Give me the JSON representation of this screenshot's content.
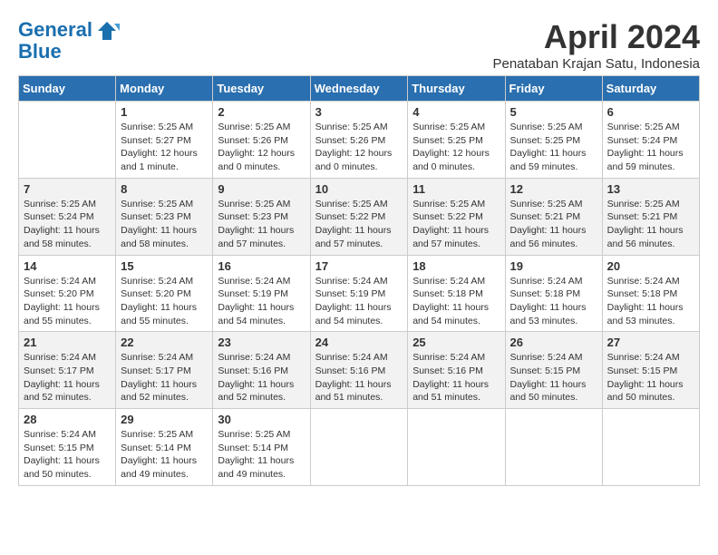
{
  "header": {
    "logo_line1": "General",
    "logo_line2": "Blue",
    "month": "April 2024",
    "location": "Penataban Krajan Satu, Indonesia"
  },
  "days_of_week": [
    "Sunday",
    "Monday",
    "Tuesday",
    "Wednesday",
    "Thursday",
    "Friday",
    "Saturday"
  ],
  "weeks": [
    [
      {
        "day": "",
        "info": ""
      },
      {
        "day": "1",
        "info": "Sunrise: 5:25 AM\nSunset: 5:27 PM\nDaylight: 12 hours\nand 1 minute."
      },
      {
        "day": "2",
        "info": "Sunrise: 5:25 AM\nSunset: 5:26 PM\nDaylight: 12 hours\nand 0 minutes."
      },
      {
        "day": "3",
        "info": "Sunrise: 5:25 AM\nSunset: 5:26 PM\nDaylight: 12 hours\nand 0 minutes."
      },
      {
        "day": "4",
        "info": "Sunrise: 5:25 AM\nSunset: 5:25 PM\nDaylight: 12 hours\nand 0 minutes."
      },
      {
        "day": "5",
        "info": "Sunrise: 5:25 AM\nSunset: 5:25 PM\nDaylight: 11 hours\nand 59 minutes."
      },
      {
        "day": "6",
        "info": "Sunrise: 5:25 AM\nSunset: 5:24 PM\nDaylight: 11 hours\nand 59 minutes."
      }
    ],
    [
      {
        "day": "7",
        "info": "Sunrise: 5:25 AM\nSunset: 5:24 PM\nDaylight: 11 hours\nand 58 minutes."
      },
      {
        "day": "8",
        "info": "Sunrise: 5:25 AM\nSunset: 5:23 PM\nDaylight: 11 hours\nand 58 minutes."
      },
      {
        "day": "9",
        "info": "Sunrise: 5:25 AM\nSunset: 5:23 PM\nDaylight: 11 hours\nand 57 minutes."
      },
      {
        "day": "10",
        "info": "Sunrise: 5:25 AM\nSunset: 5:22 PM\nDaylight: 11 hours\nand 57 minutes."
      },
      {
        "day": "11",
        "info": "Sunrise: 5:25 AM\nSunset: 5:22 PM\nDaylight: 11 hours\nand 57 minutes."
      },
      {
        "day": "12",
        "info": "Sunrise: 5:25 AM\nSunset: 5:21 PM\nDaylight: 11 hours\nand 56 minutes."
      },
      {
        "day": "13",
        "info": "Sunrise: 5:25 AM\nSunset: 5:21 PM\nDaylight: 11 hours\nand 56 minutes."
      }
    ],
    [
      {
        "day": "14",
        "info": "Sunrise: 5:24 AM\nSunset: 5:20 PM\nDaylight: 11 hours\nand 55 minutes."
      },
      {
        "day": "15",
        "info": "Sunrise: 5:24 AM\nSunset: 5:20 PM\nDaylight: 11 hours\nand 55 minutes."
      },
      {
        "day": "16",
        "info": "Sunrise: 5:24 AM\nSunset: 5:19 PM\nDaylight: 11 hours\nand 54 minutes."
      },
      {
        "day": "17",
        "info": "Sunrise: 5:24 AM\nSunset: 5:19 PM\nDaylight: 11 hours\nand 54 minutes."
      },
      {
        "day": "18",
        "info": "Sunrise: 5:24 AM\nSunset: 5:18 PM\nDaylight: 11 hours\nand 54 minutes."
      },
      {
        "day": "19",
        "info": "Sunrise: 5:24 AM\nSunset: 5:18 PM\nDaylight: 11 hours\nand 53 minutes."
      },
      {
        "day": "20",
        "info": "Sunrise: 5:24 AM\nSunset: 5:18 PM\nDaylight: 11 hours\nand 53 minutes."
      }
    ],
    [
      {
        "day": "21",
        "info": "Sunrise: 5:24 AM\nSunset: 5:17 PM\nDaylight: 11 hours\nand 52 minutes."
      },
      {
        "day": "22",
        "info": "Sunrise: 5:24 AM\nSunset: 5:17 PM\nDaylight: 11 hours\nand 52 minutes."
      },
      {
        "day": "23",
        "info": "Sunrise: 5:24 AM\nSunset: 5:16 PM\nDaylight: 11 hours\nand 52 minutes."
      },
      {
        "day": "24",
        "info": "Sunrise: 5:24 AM\nSunset: 5:16 PM\nDaylight: 11 hours\nand 51 minutes."
      },
      {
        "day": "25",
        "info": "Sunrise: 5:24 AM\nSunset: 5:16 PM\nDaylight: 11 hours\nand 51 minutes."
      },
      {
        "day": "26",
        "info": "Sunrise: 5:24 AM\nSunset: 5:15 PM\nDaylight: 11 hours\nand 50 minutes."
      },
      {
        "day": "27",
        "info": "Sunrise: 5:24 AM\nSunset: 5:15 PM\nDaylight: 11 hours\nand 50 minutes."
      }
    ],
    [
      {
        "day": "28",
        "info": "Sunrise: 5:24 AM\nSunset: 5:15 PM\nDaylight: 11 hours\nand 50 minutes."
      },
      {
        "day": "29",
        "info": "Sunrise: 5:25 AM\nSunset: 5:14 PM\nDaylight: 11 hours\nand 49 minutes."
      },
      {
        "day": "30",
        "info": "Sunrise: 5:25 AM\nSunset: 5:14 PM\nDaylight: 11 hours\nand 49 minutes."
      },
      {
        "day": "",
        "info": ""
      },
      {
        "day": "",
        "info": ""
      },
      {
        "day": "",
        "info": ""
      },
      {
        "day": "",
        "info": ""
      }
    ]
  ]
}
